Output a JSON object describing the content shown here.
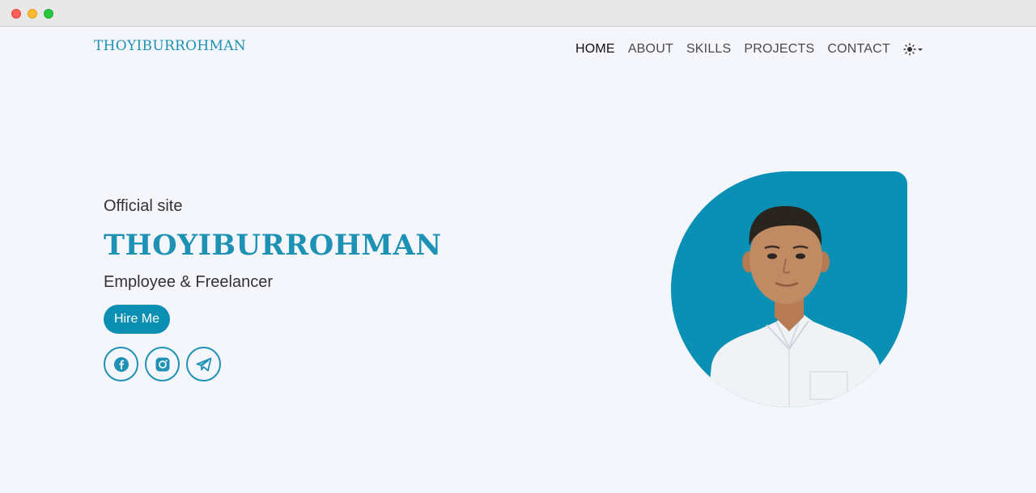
{
  "brand": {
    "name": "THOYIBURROHMAN",
    "color": "#1d92b5"
  },
  "nav": {
    "items": [
      {
        "label": "HOME",
        "active": true
      },
      {
        "label": "ABOUT",
        "active": false
      },
      {
        "label": "SKILLS",
        "active": false
      },
      {
        "label": "PROJECTS",
        "active": false
      },
      {
        "label": "CONTACT",
        "active": false
      }
    ],
    "theme_toggle_icon": "sun-icon",
    "theme_dropdown_icon": "caret-down-icon"
  },
  "hero": {
    "subtitle": "Official site",
    "name": "THOYIBURROHMAN",
    "role": "Employee & Freelancer",
    "cta_label": "Hire Me",
    "socials": [
      {
        "icon": "facebook-icon"
      },
      {
        "icon": "instagram-icon"
      },
      {
        "icon": "telegram-icon"
      }
    ],
    "photo_bg_color": "#0a90b4"
  },
  "colors": {
    "accent": "#1d92b5",
    "button": "#0b8fb3",
    "background": "#f5f6fc"
  }
}
